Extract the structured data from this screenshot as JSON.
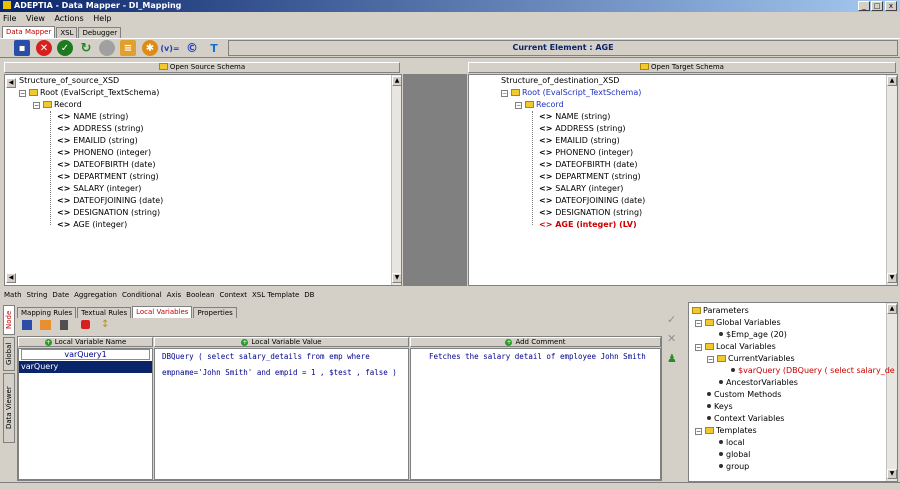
{
  "window": {
    "title": "ADEPTIA - Data Mapper - DI_Mapping",
    "controls": [
      "_",
      "□",
      "x"
    ]
  },
  "menu": [
    "File",
    "View",
    "Actions",
    "Help"
  ],
  "main_tabs": [
    {
      "label": "Data Mapper",
      "active": true
    },
    {
      "label": "XSL",
      "active": false
    },
    {
      "label": "Debugger",
      "active": false
    }
  ],
  "toolbar": {
    "icons": [
      "save-icon",
      "open-icon",
      "delete-icon",
      "check-icon",
      "refresh-icon",
      "stop-icon",
      "list-icon",
      "settings-icon",
      "variable-icon",
      "constant-icon",
      "text-icon"
    ],
    "variable_glyph": "(v)=",
    "constant_glyph": "©",
    "text_glyph": "T"
  },
  "current_element": "Current Element : AGE",
  "source": {
    "button": "Open Source Schema",
    "root_label": "Structure_of_source_XSD",
    "root_node": "Root (EvalScript_TextSchema)",
    "record": "Record",
    "fields": [
      "NAME (string)",
      "ADDRESS (string)",
      "EMAILID (string)",
      "PHONENO (integer)",
      "DATEOFBIRTH (date)",
      "DEPARTMENT (string)",
      "SALARY (integer)",
      "DATEOFJOINING (date)",
      "DESIGNATION (string)",
      "AGE (integer)"
    ]
  },
  "target": {
    "button": "Open Target Schema",
    "root_label": "Structure_of_destination_XSD",
    "root_node": "Root (EvalScript_TextSchema)",
    "record": "Record",
    "fields": [
      "NAME (string)",
      "ADDRESS (string)",
      "EMAILID (string)",
      "PHONENO (integer)",
      "DATEOFBIRTH (date)",
      "DEPARTMENT (string)",
      "SALARY (integer)",
      "DATEOFJOINING (date)",
      "DESIGNATION (string)",
      "AGE (integer) (LV)"
    ],
    "highlight_color": "#cc0000"
  },
  "function_bar": [
    "Math",
    "String",
    "Date",
    "Aggregation",
    "Conditional",
    "Axis",
    "Boolean",
    "Context",
    "XSL Template",
    "DB"
  ],
  "side_tabs": [
    "Node",
    "Global",
    "Data Viewer"
  ],
  "rule_tabs": [
    {
      "label": "Mapping Rules",
      "active": false
    },
    {
      "label": "Textual Rules",
      "active": false
    },
    {
      "label": "Local Variables",
      "active": true
    },
    {
      "label": "Properties",
      "active": false
    }
  ],
  "local_vars": {
    "col_name": "Local Variable Name",
    "col_value": "Local Variable Value",
    "col_comment": "Add Comment",
    "name_input": "varQuery1",
    "selected_row": "varQuery",
    "value_line1": "DBQuery ( select salary_details from emp where",
    "value_line2": "empname='John Smith' and empid = 1 , $test , false )",
    "comment": "Fetches the salary detail of employee John Smith"
  },
  "params_tree": {
    "parameters": "Parameters",
    "global_variables": "Global Variables",
    "emp_age": "$Emp_age (20)",
    "local_variables": "Local Variables",
    "current_variables": "CurrentVariables",
    "var_query": "$varQuery (DBQuery ( select salary_de",
    "ancestor_variables": "AncestorVariables",
    "custom_methods": "Custom Methods",
    "keys": "Keys",
    "context_variables": "Context Variables",
    "templates": "Templates",
    "local": "local",
    "global": "global",
    "group": "group"
  },
  "colors": {
    "accent_blue": "#0a246a",
    "selection": "#0a246a",
    "highlight_red": "#cc0000"
  }
}
